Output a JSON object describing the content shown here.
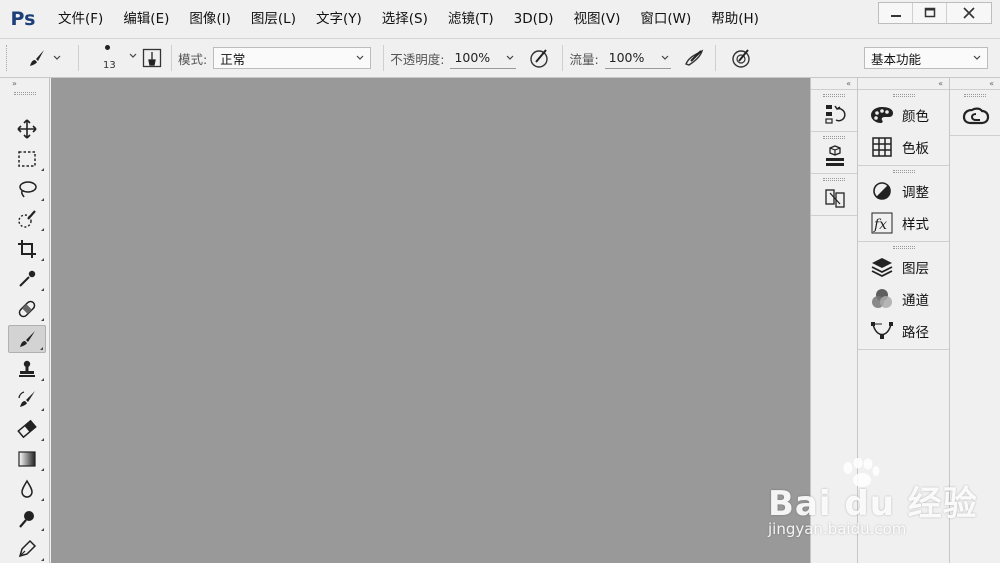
{
  "app": {
    "logo": "Ps"
  },
  "menu": [
    "文件(F)",
    "编辑(E)",
    "图像(I)",
    "图层(L)",
    "文字(Y)",
    "选择(S)",
    "滤镜(T)",
    "3D(D)",
    "视图(V)",
    "窗口(W)",
    "帮助(H)"
  ],
  "options": {
    "brush_size": "13",
    "mode_label": "模式:",
    "mode_value": "正常",
    "opacity_label": "不透明度:",
    "opacity_value": "100%",
    "flow_label": "流量:",
    "flow_value": "100%",
    "workspace": "基本功能"
  },
  "toolbar": {
    "tools": [
      "move-tool",
      "marquee-tool",
      "lasso-tool",
      "quick-selection-tool",
      "crop-tool",
      "eyedropper-tool",
      "healing-brush-tool",
      "brush-tool",
      "clone-stamp-tool",
      "history-brush-tool",
      "eraser-tool",
      "gradient-tool",
      "blur-tool",
      "dodge-tool",
      "pen-tool"
    ],
    "active": "brush-tool"
  },
  "panels": {
    "group1": [
      "颜色",
      "色板"
    ],
    "group2": [
      "调整",
      "样式"
    ],
    "group3": [
      "图层",
      "通道",
      "路径"
    ]
  },
  "watermark": {
    "main": "Bai du 经验",
    "sub": "jingyan.baidu.com"
  },
  "colors": {
    "canvas": "#999999",
    "chrome": "#f0f0f0",
    "logo": "#1c3f7a"
  }
}
